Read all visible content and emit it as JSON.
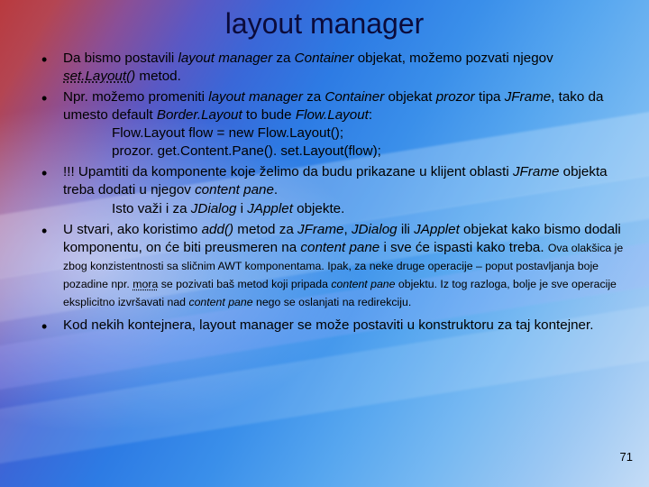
{
  "title": "layout manager",
  "bullets": {
    "b1": "Da bismo postavili layout manager za Container objekat, možemo pozvati njegov set.Layout() metod.",
    "b2a": "Npr. možemo promeniti layout manager za Container objekat prozor tipa JFrame, tako da umesto default Border.Layout to bude Flow.Layout:",
    "b2_code1": "Flow.Layout flow = new Flow.Layout();",
    "b2_code2": "prozor. get.Content.Pane(). set.Layout(flow);",
    "b3a": "!!! Upamtiti da komponente koje želimo da budu prikazane u klijent oblasti JFrame objekta treba dodati u njegov content pane.",
    "b3b": "Isto važi i za JDialog i JApplet objekte.",
    "b4a": "U stvari, ako koristimo add() metod za JFrame, JDialog ili JApplet objekat kako bismo dodali komponentu, on će biti preusmeren na content pane i sve će ispasti kako treba.",
    "b4small": "Ova olakšica je zbog konzistentnosti sa sličnim AWT komponentama. Ipak, za neke druge operacije – poput postavljanja boje pozadine npr. mora se pozivati baš metod koji pripada content pane objektu. Iz tog razloga, bolje je sve operacije eksplicitno izvršavati nad content pane nego se oslanjati na redirekciju.",
    "b5": "Kod nekih kontejnera, layout manager se može postaviti u konstruktoru za taj kontejner."
  },
  "page": "71"
}
